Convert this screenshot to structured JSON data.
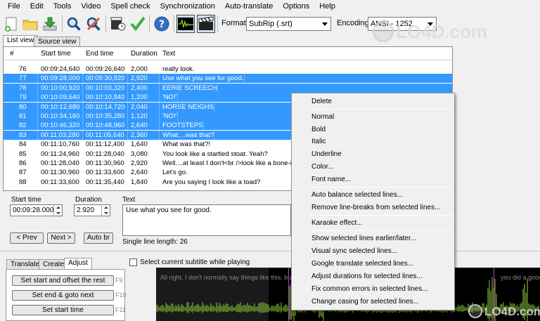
{
  "menu": [
    "File",
    "Edit",
    "Tools",
    "Video",
    "Spell check",
    "Synchronization",
    "Auto-translate",
    "Options",
    "Help"
  ],
  "toolbar": {
    "format_label": "Format",
    "format_value": "SubRip (.srt)",
    "encoding_label": "Encoding",
    "encoding_value": "ANSI - 1252"
  },
  "tabs": {
    "list_view": "List view",
    "source_view": "Source view"
  },
  "grid": {
    "columns": [
      "#",
      "Start time",
      "End time",
      "Duration",
      "Text"
    ],
    "rows": [
      {
        "num": "76",
        "start": "00:09:24,640",
        "end": "00:09:26,640",
        "dur": "2,000",
        "text": "really look.",
        "selected": false
      },
      {
        "num": "77",
        "start": "00:09:28,000",
        "end": "00:09:30,920",
        "dur": "2,920",
        "text": "Use what you see for good.",
        "selected": true
      },
      {
        "num": "78",
        "start": "00:10:00,920",
        "end": "00:10:03,320",
        "dur": "2,400",
        "text": "EERIE SCREECH",
        "selected": true
      },
      {
        "num": "79",
        "start": "00:10:09,640",
        "end": "00:10:10,840",
        "dur": "1,200",
        "text": "'NO!'",
        "selected": true
      },
      {
        "num": "80",
        "start": "00:10:12,680",
        "end": "00:10:14,720",
        "dur": "2,040",
        "text": "HORSE NEIGHS",
        "selected": true
      },
      {
        "num": "81",
        "start": "00:10:34,160",
        "end": "00:10:35,280",
        "dur": "1,120",
        "text": "'NO!'",
        "selected": true
      },
      {
        "num": "82",
        "start": "00:10:46,320",
        "end": "00:10:48,960",
        "dur": "2,640",
        "text": "FOOTSTEPS",
        "selected": true
      },
      {
        "num": "83",
        "start": "00:11:03,280",
        "end": "00:11:05,640",
        "dur": "2,360",
        "text": "What....was that?",
        "selected": true
      },
      {
        "num": "84",
        "start": "00:11:10,760",
        "end": "00:11:12,400",
        "dur": "1,640",
        "text": "What was that?!",
        "selected": false
      },
      {
        "num": "85",
        "start": "00:11:24,960",
        "end": "00:11:28,040",
        "dur": "3,080",
        "text": "You look like a startled stoat. Yeah?",
        "selected": false
      },
      {
        "num": "86",
        "start": "00:11:28,040",
        "end": "00:11:30,960",
        "dur": "2,920",
        "text": "Well....at least I don't<br />look like a bone-idle",
        "selected": false
      },
      {
        "num": "87",
        "start": "00:11:30,960",
        "end": "00:11:33,600",
        "dur": "2,640",
        "text": "Let's go.",
        "selected": false
      },
      {
        "num": "88",
        "start": "00:11:33,600",
        "end": "00:11:35,440",
        "dur": "1,840",
        "text": "Are you saying I look like a toad?",
        "selected": false
      }
    ]
  },
  "edit": {
    "start_label": "Start time",
    "start_value": "00:09:28.000",
    "duration_label": "Duration",
    "duration_value": "2.920",
    "text_label": "Text",
    "text_value": "Use what you see for good.",
    "prev": "< Prev",
    "next": "Next >",
    "autobr": "Auto br",
    "line_length": "Single line length:  26"
  },
  "lower_tabs": [
    "Translate",
    "Create",
    "Adjust"
  ],
  "adjust_buttons": [
    {
      "label": "Set start and offset the rest",
      "key": "F9"
    },
    {
      "label": "Set end & goto next",
      "key": "F10"
    },
    {
      "label": "Set start time",
      "key": "F11"
    }
  ],
  "follow_checkbox": "Select current subtitle while playing",
  "waveform": {
    "text_left": "All right, I don't normally say things like this, but",
    "text_right": "you did a good"
  },
  "context_menu": [
    "Delete",
    "Normal",
    "Bold",
    "Italic",
    "Underline",
    "Color...",
    "Font name...",
    "Auto balance selected lines...",
    "Remove line-breaks from selected lines...",
    "Karaoke effect...",
    "Show selected lines earlier/later...",
    "Visual sync selected lines...",
    "Google translate selected lines...",
    "Adjust durations for selected lines...",
    "Fix common errors in selected lines...",
    "Change casing for selected lines..."
  ],
  "watermark": "LO4D.com",
  "colors": {
    "selection": "#3399ff",
    "waveform_bg": "#000000",
    "wave": "#8fd13f",
    "marker": "#b93bd6"
  }
}
